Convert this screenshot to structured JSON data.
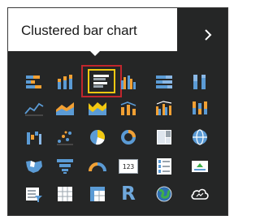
{
  "tooltip": {
    "text": "Clustered bar chart"
  },
  "expand_button": {
    "icon": "chevron-right-icon"
  },
  "visuals": [
    [
      "stacked-bar-chart-icon",
      "stacked-column-chart-icon",
      "clustered-bar-chart-icon",
      "clustered-column-chart-icon",
      "100-percent-stacked-bar-chart-icon",
      "100-percent-stacked-column-chart-icon"
    ],
    [
      "line-chart-icon",
      "area-chart-icon",
      "stacked-area-chart-icon",
      "line-and-stacked-column-chart-icon",
      "line-and-clustered-column-chart-icon",
      "ribbon-chart-icon"
    ],
    [
      "waterfall-chart-icon",
      "scatter-chart-icon",
      "pie-chart-icon",
      "donut-chart-icon",
      "treemap-icon",
      "map-icon"
    ],
    [
      "filled-map-icon",
      "funnel-icon",
      "gauge-icon",
      "card-icon",
      "multi-row-card-icon",
      "kpi-icon"
    ],
    [
      "slicer-icon",
      "table-icon",
      "matrix-icon",
      "r-script-visual-icon",
      "arcgis-map-icon",
      "cloud-visual-icon"
    ]
  ],
  "selected_visual": "clustered-bar-chart-icon",
  "card_label": "123",
  "r_label": "R",
  "colors": {
    "panel": "#252626",
    "accent_yellow": "#f2c811",
    "selection_red": "#c0262d",
    "icon_blue": "#5b9bd5",
    "icon_orange": "#f2a033"
  }
}
